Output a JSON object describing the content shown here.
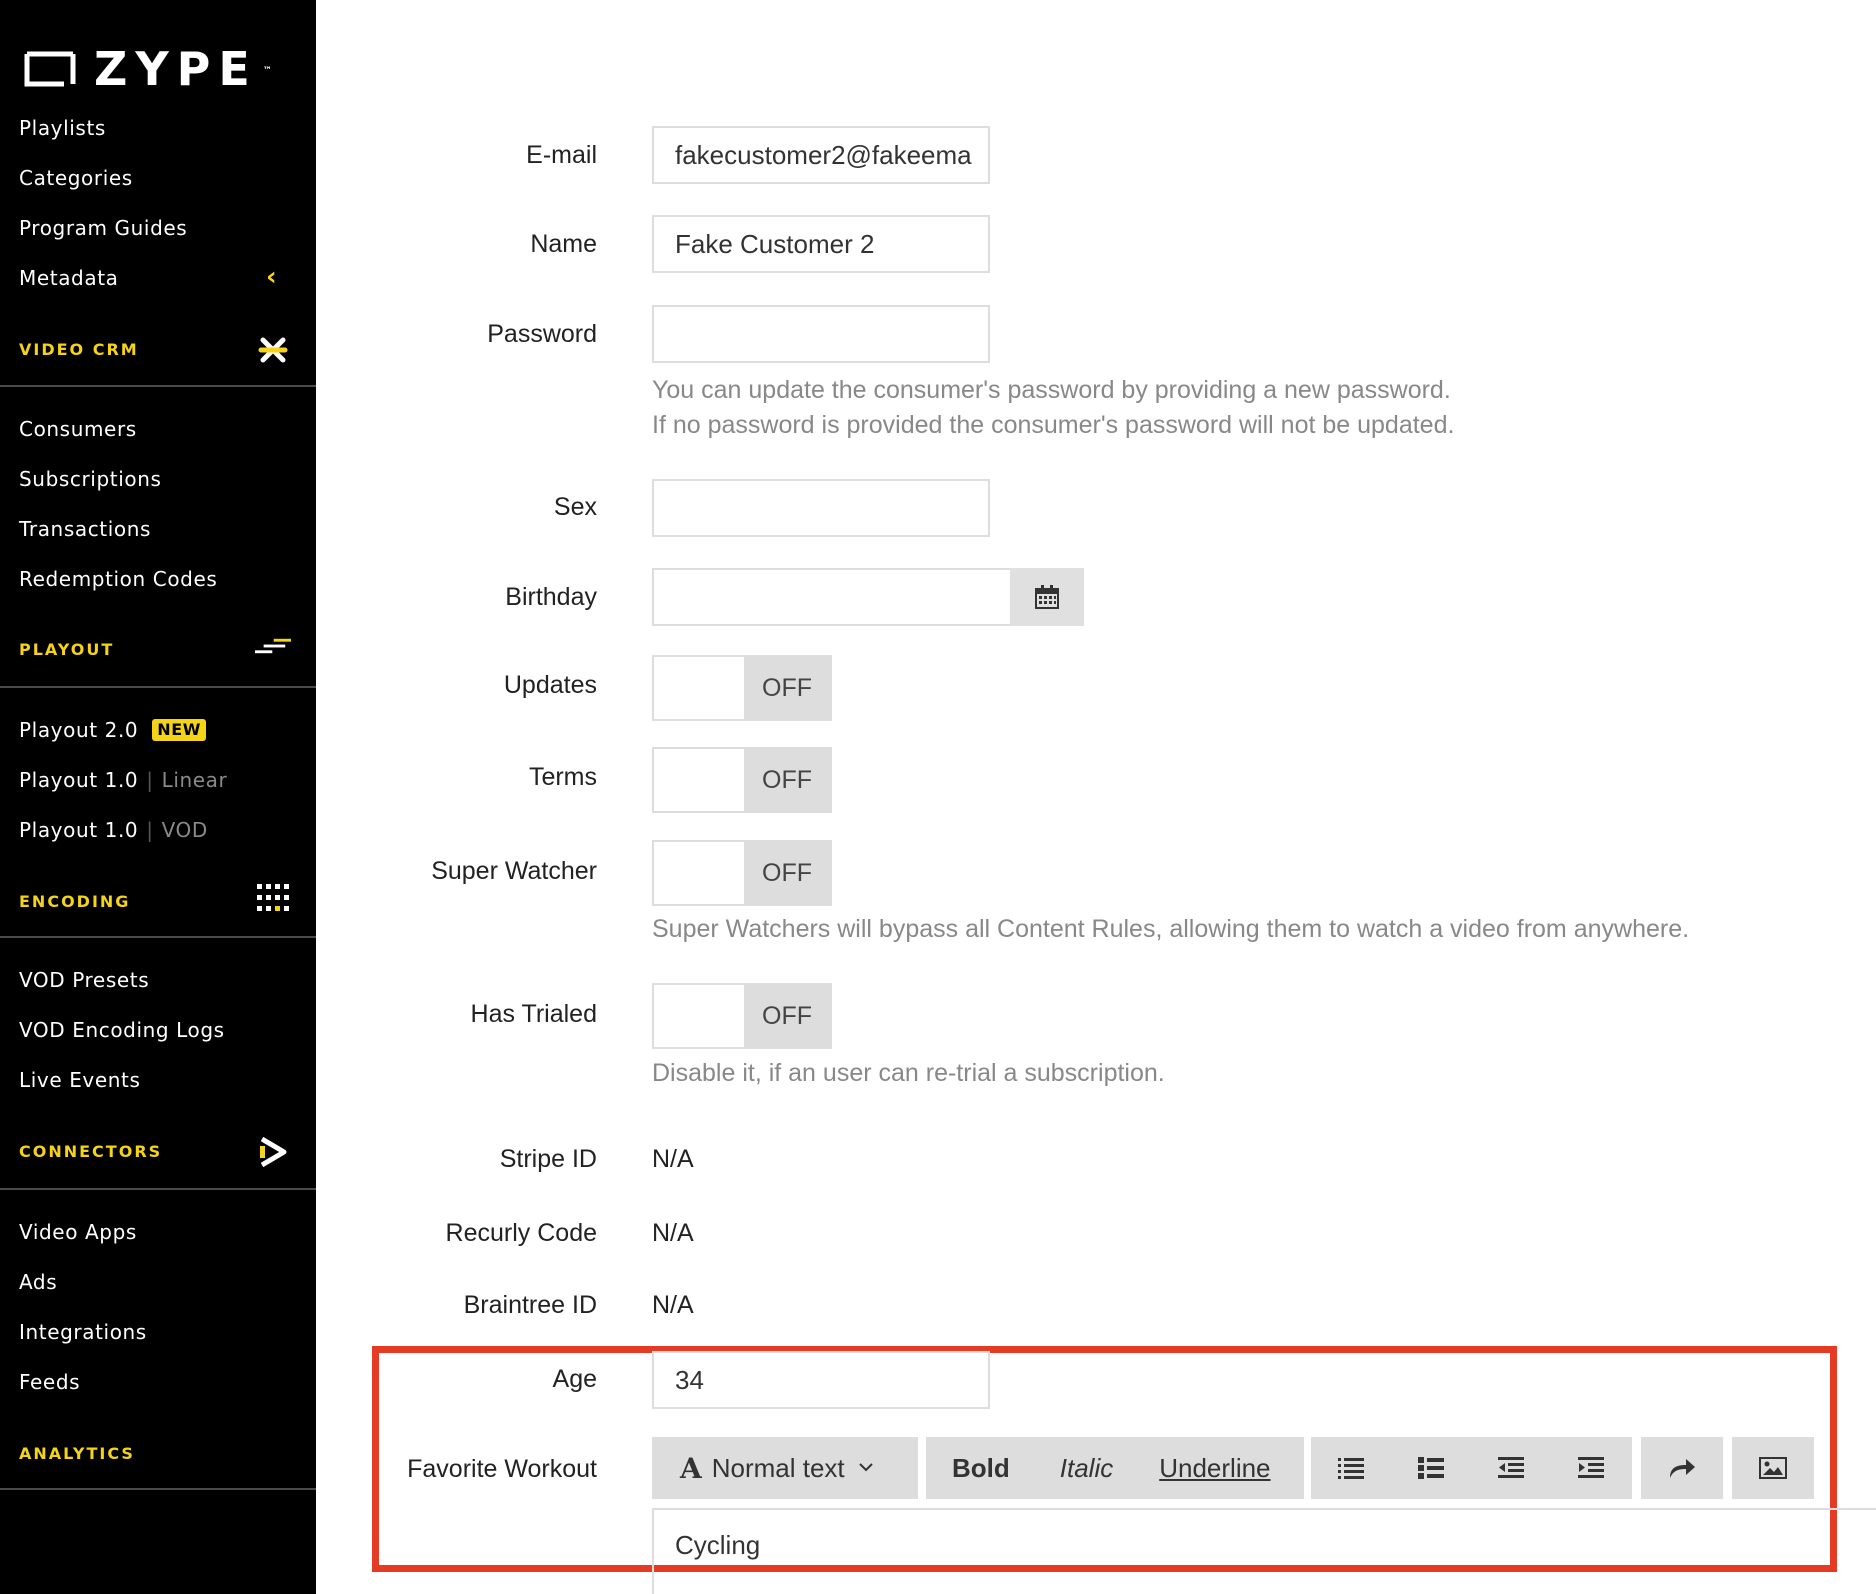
{
  "brand": {
    "name": "ZYPE",
    "tm": "™"
  },
  "sidebar": {
    "items_top": [
      "Playlists",
      "Categories",
      "Program Guides",
      "Metadata"
    ],
    "sections": {
      "video_crm": {
        "title": "VIDEO CRM",
        "items": [
          "Consumers",
          "Subscriptions",
          "Transactions",
          "Redemption Codes"
        ]
      },
      "playout": {
        "title": "PLAYOUT",
        "items": [
          {
            "label": "Playout 2.0",
            "badge": "NEW"
          },
          {
            "label": "Playout 1.0",
            "sep": "|",
            "sub": "Linear"
          },
          {
            "label": "Playout 1.0",
            "sep": "|",
            "sub": "VOD"
          }
        ]
      },
      "encoding": {
        "title": "ENCODING",
        "items": [
          "VOD Presets",
          "VOD Encoding Logs",
          "Live Events"
        ]
      },
      "connectors": {
        "title": "CONNECTORS",
        "items": [
          "Video Apps",
          "Ads",
          "Integrations",
          "Feeds"
        ]
      },
      "analytics": {
        "title": "ANALYTICS"
      }
    }
  },
  "form": {
    "email": {
      "label": "E-mail",
      "value": "fakecustomer2@fakeema"
    },
    "name": {
      "label": "Name",
      "value": "Fake Customer 2"
    },
    "password": {
      "label": "Password",
      "value": "",
      "help1": "You can update the consumer's password by providing a new password.",
      "help2": "If no password is provided the consumer's password will not be updated."
    },
    "sex": {
      "label": "Sex",
      "value": ""
    },
    "birthday": {
      "label": "Birthday",
      "value": ""
    },
    "updates": {
      "label": "Updates",
      "state": "OFF"
    },
    "terms": {
      "label": "Terms",
      "state": "OFF"
    },
    "super_watcher": {
      "label": "Super Watcher",
      "state": "OFF",
      "help": "Super Watchers will bypass all Content Rules, allowing them to watch a video from anywhere."
    },
    "has_trialed": {
      "label": "Has Trialed",
      "state": "OFF",
      "help": "Disable it, if an user can re-trial a subscription."
    },
    "stripe_id": {
      "label": "Stripe ID",
      "value": "N/A"
    },
    "recurly_code": {
      "label": "Recurly Code",
      "value": "N/A"
    },
    "braintree_id": {
      "label": "Braintree ID",
      "value": "N/A"
    },
    "age": {
      "label": "Age",
      "value": "34"
    },
    "favorite_workout": {
      "label": "Favorite Workout",
      "toolbar": {
        "format": "Normal text",
        "bold": "Bold",
        "italic": "Italic",
        "underline": "Underline"
      },
      "content": "Cycling"
    }
  },
  "colors": {
    "accent": "#f5d317",
    "highlight": "#e53a24",
    "sidebar_bg": "#000000"
  }
}
